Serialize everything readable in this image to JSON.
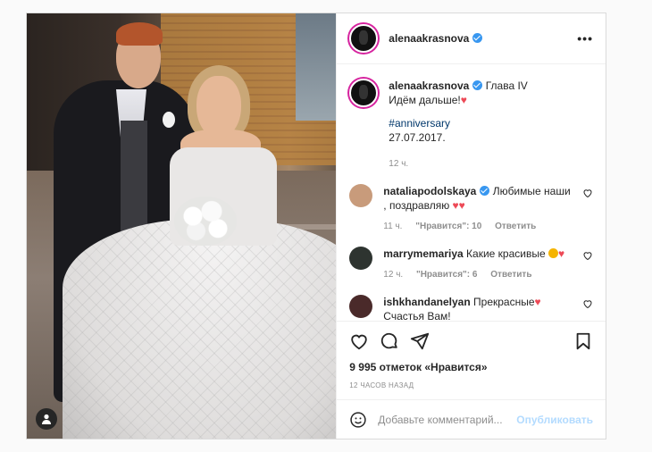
{
  "post": {
    "author": "alenaakrasnova",
    "more_icon": "•••",
    "caption": {
      "username": "alenaakrasnova",
      "line1": "Глава IV",
      "line2": "Идём дальше!",
      "hashtag": "#anniversary",
      "date_line": "27.07.2017.",
      "age": "12 ч."
    },
    "comments": [
      {
        "username": "nataliapodolskaya",
        "text": "Любимые наши , поздравляю",
        "age": "11 ч.",
        "likes": "\"Нравится\": 10",
        "reply": "Ответить",
        "avatar_color": "#c89b7b"
      },
      {
        "username": "marrymemariya",
        "text": "Какие красивые",
        "age": "12 ч.",
        "likes": "\"Нравится\": 6",
        "reply": "Ответить",
        "avatar_color": "#2e3430"
      },
      {
        "username": "ishkhandanelyan",
        "text": "Прекрасные",
        "text2": "Счастья Вам!",
        "avatar_color": "#4a2a2a"
      }
    ],
    "likes_text": "9 995 отметок «Нравится»",
    "time_ago": "12 ЧАСОВ НАЗАД",
    "comment_placeholder": "Добавьте комментарий...",
    "publish_label": "Опубликовать",
    "colors": {
      "verified": "#3897f0",
      "heart": "#ed4956",
      "link": "#00376b",
      "publish": "#b3dbff"
    }
  }
}
